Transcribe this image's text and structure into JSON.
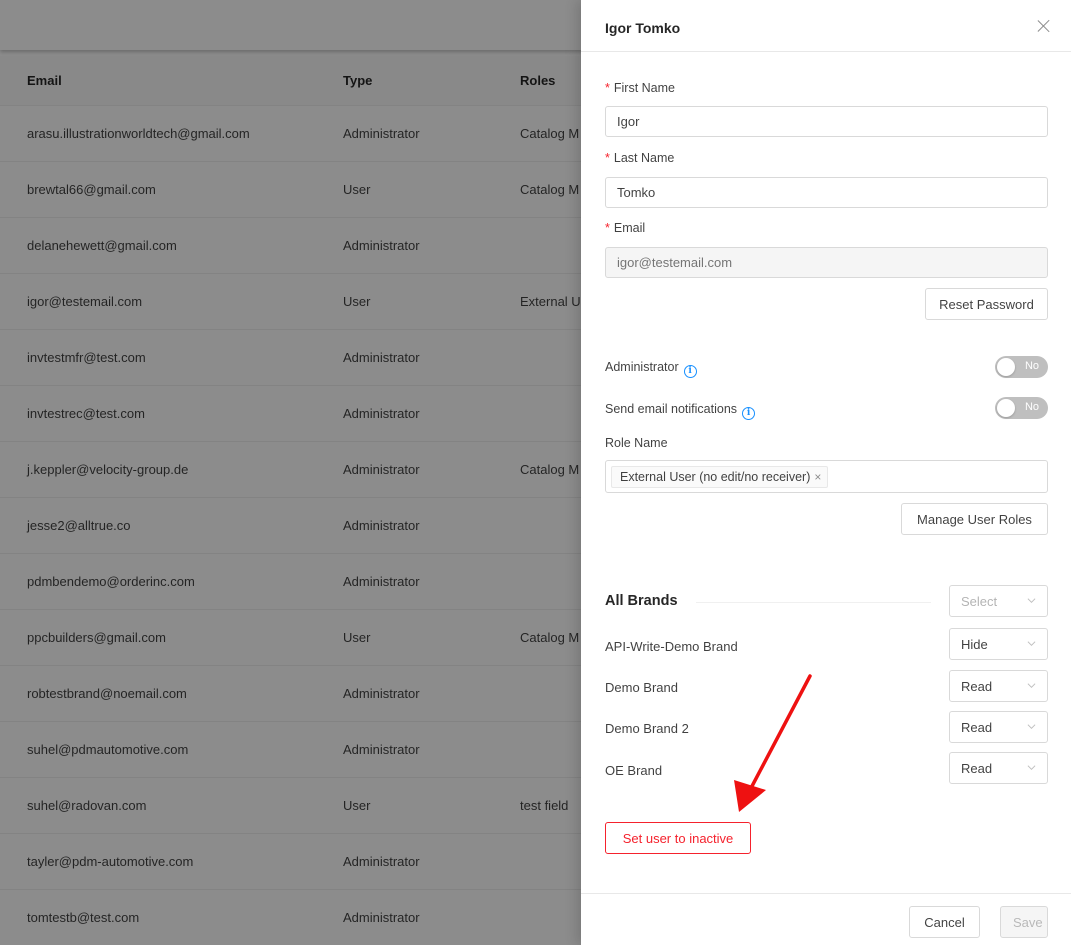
{
  "table": {
    "headers": {
      "email": "Email",
      "type": "Type",
      "roles": "Roles"
    },
    "rows": [
      {
        "email": "arasu.illustrationworldtech@gmail.com",
        "type": "Administrator",
        "roles": "Catalog M"
      },
      {
        "email": "brewtal66@gmail.com",
        "type": "User",
        "roles": "Catalog M"
      },
      {
        "email": "delanehewett@gmail.com",
        "type": "Administrator",
        "roles": ""
      },
      {
        "email": "igor@testemail.com",
        "type": "User",
        "roles": "External U"
      },
      {
        "email": "invtestmfr@test.com",
        "type": "Administrator",
        "roles": ""
      },
      {
        "email": "invtestrec@test.com",
        "type": "Administrator",
        "roles": ""
      },
      {
        "email": "j.keppler@velocity-group.de",
        "type": "Administrator",
        "roles": "Catalog M"
      },
      {
        "email": "jesse2@alltrue.co",
        "type": "Administrator",
        "roles": ""
      },
      {
        "email": "pdmbendemo@orderinc.com",
        "type": "Administrator",
        "roles": ""
      },
      {
        "email": "ppcbuilders@gmail.com",
        "type": "User",
        "roles": "Catalog M"
      },
      {
        "email": "robtestbrand@noemail.com",
        "type": "Administrator",
        "roles": ""
      },
      {
        "email": "suhel@pdmautomotive.com",
        "type": "Administrator",
        "roles": ""
      },
      {
        "email": "suhel@radovan.com",
        "type": "User",
        "roles": "test field"
      },
      {
        "email": "tayler@pdm-automotive.com",
        "type": "Administrator",
        "roles": ""
      },
      {
        "email": "tomtestb@test.com",
        "type": "Administrator",
        "roles": ""
      }
    ]
  },
  "drawer": {
    "title": "Igor Tomko",
    "first_name": {
      "label": "First Name",
      "value": "Igor",
      "required": "*"
    },
    "last_name": {
      "label": "Last Name",
      "value": "Tomko",
      "required": "*"
    },
    "email": {
      "label": "Email",
      "placeholder": "igor@testemail.com",
      "required": "*"
    },
    "reset_password": "Reset Password",
    "administrator": {
      "label": "Administrator",
      "state": "No"
    },
    "email_notifications": {
      "label": "Send email notifications",
      "state": "No"
    },
    "role_name": {
      "label": "Role Name",
      "tag": "External User (no edit/no receiver)",
      "tag_remove": "×"
    },
    "manage_roles": "Manage User Roles",
    "brands": {
      "title": "All Brands",
      "all_select": "Select",
      "items": [
        {
          "name": "API-Write-Demo Brand",
          "value": "Hide"
        },
        {
          "name": "Demo Brand",
          "value": "Read"
        },
        {
          "name": "Demo Brand 2",
          "value": "Read"
        },
        {
          "name": "OE Brand",
          "value": "Read"
        }
      ]
    },
    "inactive_button": "Set user to inactive",
    "cancel": "Cancel",
    "save": "Save"
  },
  "colors": {
    "danger": "#f5222d",
    "info": "#1890ff",
    "annotation": "#ee1111"
  },
  "icons": {
    "close": "close-icon",
    "info": "info-icon",
    "chevron": "chevron-down-icon",
    "arrow": "red-arrow-annotation"
  }
}
